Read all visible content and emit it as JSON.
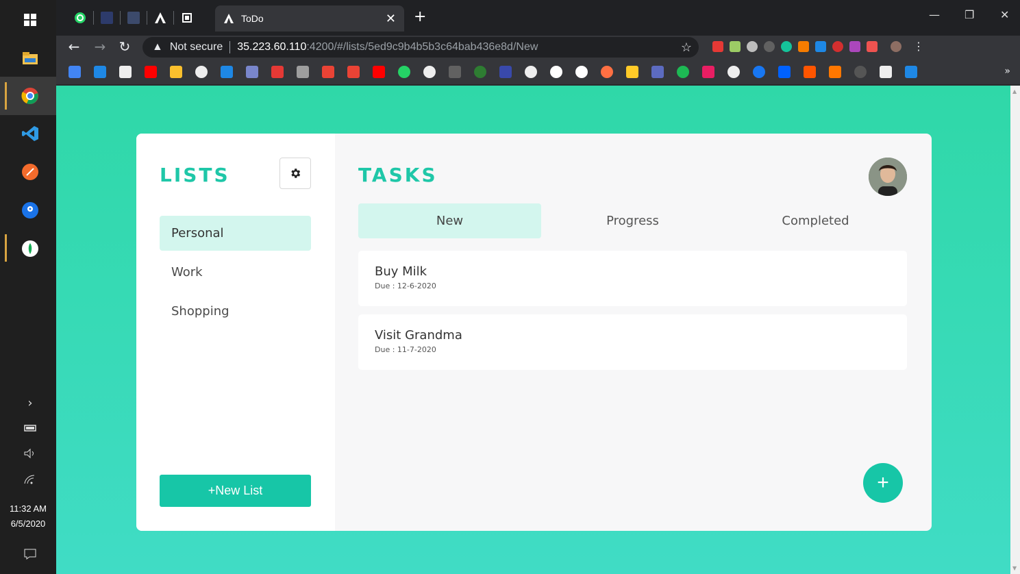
{
  "taskbar": {
    "time": "11:32 AM",
    "date": "6/5/2020"
  },
  "browser": {
    "tab_title": "ToDo",
    "url_warning": "Not secure",
    "url_host": "35.223.60.110",
    "url_path": ":4200/#/lists/5ed9c9b4b5b3c64bab436e8d/New"
  },
  "sidebar": {
    "heading": "LISTS",
    "items": [
      {
        "label": "Personal"
      },
      {
        "label": "Work"
      },
      {
        "label": "Shopping"
      }
    ],
    "new_list_label": "+New List"
  },
  "main": {
    "heading": "TASKS",
    "tabs": [
      {
        "label": "New"
      },
      {
        "label": "Progress"
      },
      {
        "label": "Completed"
      }
    ],
    "tasks": [
      {
        "name": "Buy Milk",
        "due": "Due : 12-6-2020"
      },
      {
        "name": "Visit Grandma",
        "due": "Due : 11-7-2020"
      }
    ],
    "add_label": "+"
  },
  "colors": {
    "accent": "#17c6a7",
    "active_bg": "#d3f6ee",
    "page_gradient_top": "#2fd8a8",
    "page_gradient_bottom": "#40dcc5"
  }
}
